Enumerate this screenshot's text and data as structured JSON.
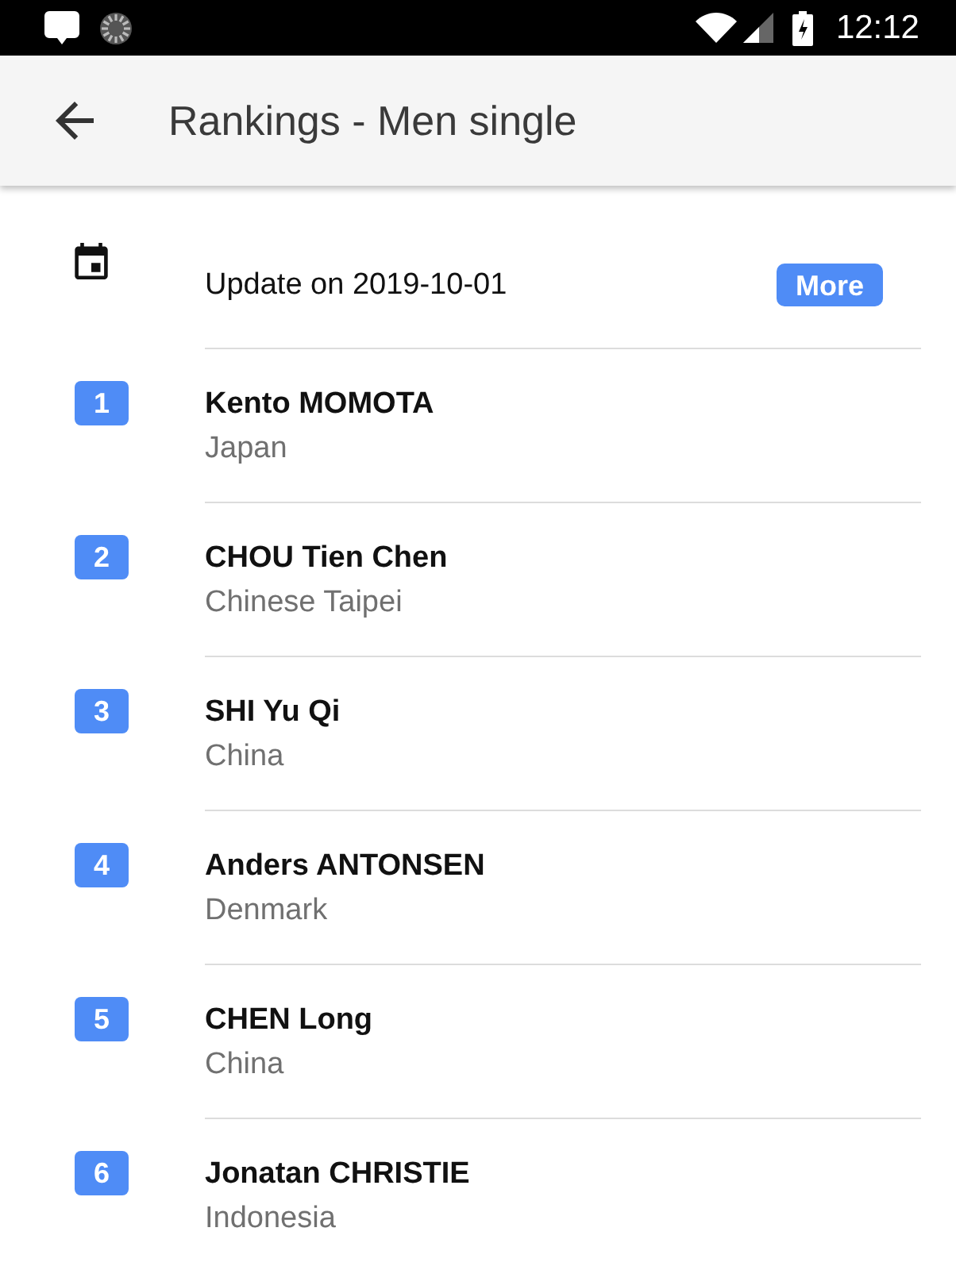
{
  "status_bar": {
    "time": "12:12"
  },
  "app_bar": {
    "title": "Rankings - Men single"
  },
  "update": {
    "text": "Update on 2019-10-01",
    "button": "More"
  },
  "rankings": [
    {
      "rank": "1",
      "name": "Kento MOMOTA",
      "country": "Japan"
    },
    {
      "rank": "2",
      "name": "CHOU Tien Chen",
      "country": "Chinese Taipei"
    },
    {
      "rank": "3",
      "name": "SHI Yu Qi",
      "country": "China"
    },
    {
      "rank": "4",
      "name": "Anders ANTONSEN",
      "country": "Denmark"
    },
    {
      "rank": "5",
      "name": "CHEN Long",
      "country": "China"
    },
    {
      "rank": "6",
      "name": "Jonatan CHRISTIE",
      "country": "Indonesia"
    }
  ]
}
